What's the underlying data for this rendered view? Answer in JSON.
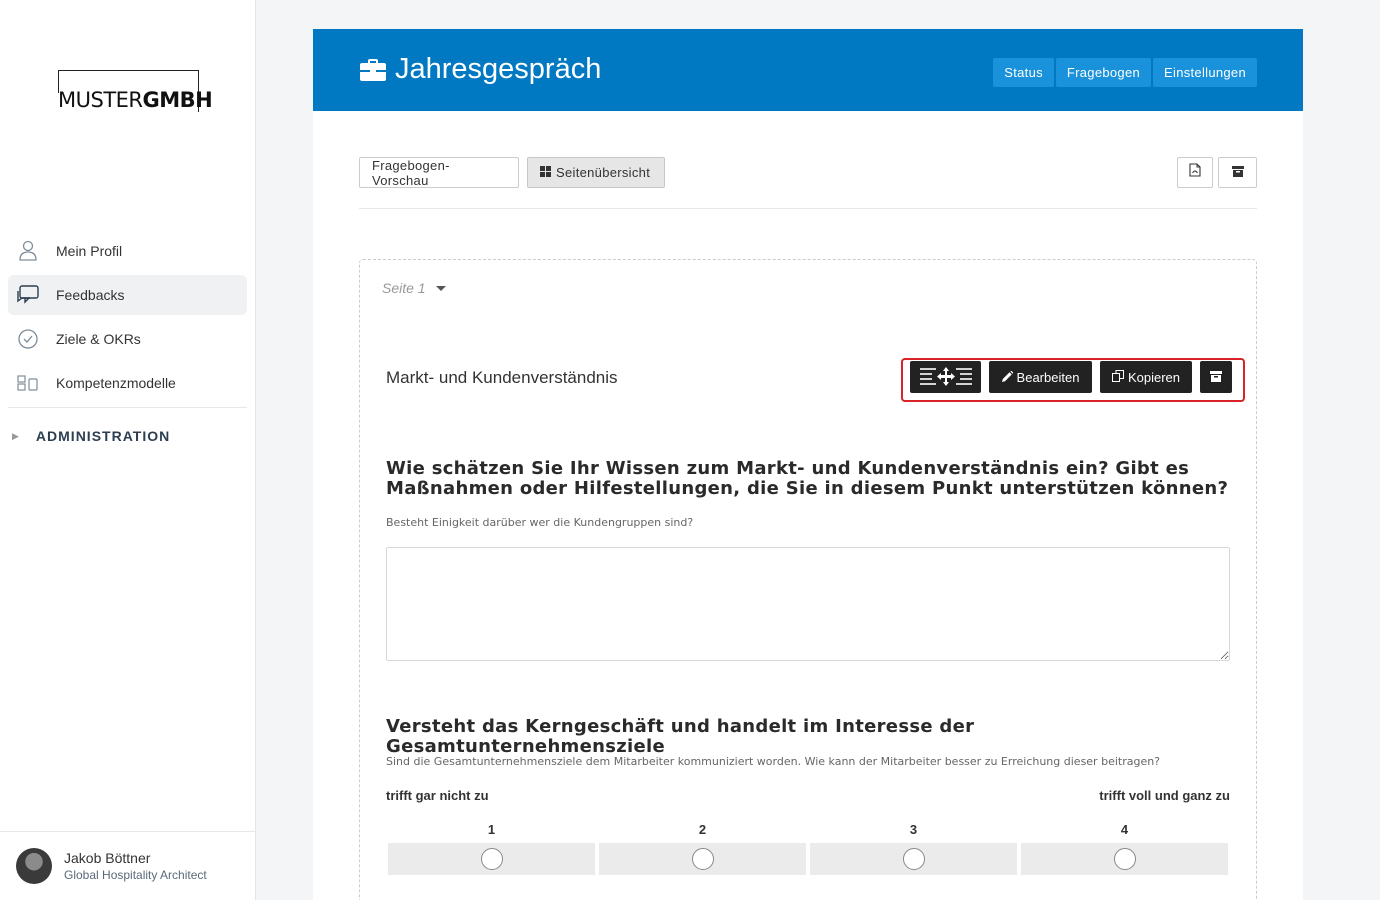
{
  "sidebar": {
    "logo": {
      "part1": "MUSTER",
      "part2": "GMBH"
    },
    "items": [
      {
        "label": "Mein Profil",
        "icon": "user-icon"
      },
      {
        "label": "Feedbacks",
        "icon": "chat-icon"
      },
      {
        "label": "Ziele & OKRs",
        "icon": "check-circle-icon"
      },
      {
        "label": "Kompetenzmodelle",
        "icon": "model-icon"
      }
    ],
    "admin_label": "ADMINISTRATION",
    "user": {
      "name": "Jakob Böttner",
      "role": "Global Hospitality Architect"
    }
  },
  "header": {
    "title": "Jahresgespräch",
    "buttons": [
      "Status",
      "Fragebogen",
      "Einstellungen"
    ]
  },
  "toolbar": {
    "preview_label": "Fragebogen-Vorschau",
    "overview_label": "Seitenübersicht"
  },
  "page": {
    "selector": "Seite 1",
    "section_title": "Markt- und Kundenverständnis",
    "actions": {
      "edit": "Bearbeiten",
      "copy": "Kopieren"
    },
    "questions": [
      {
        "title": "Wie schätzen Sie Ihr Wissen zum Markt- und Kundenverständnis ein? Gibt es Maßnahmen oder Hilfestellungen, die Sie in diesem Punkt unterstützen können?",
        "help": "Besteht Einigkeit darüber wer die Kundengruppen sind?"
      },
      {
        "title": "Versteht das Kerngeschäft und handelt im Interesse der Gesamtunternehmensziele",
        "help": "Sind die Gesamtunternehmensziele dem Mitarbeiter kommuniziert worden. Wie kann der Mitarbeiter besser zu Erreichung dieser beitragen?",
        "scale_min": "trifft gar nicht zu",
        "scale_max": "trifft voll und ganz zu",
        "scale": [
          "1",
          "2",
          "3",
          "4"
        ]
      }
    ]
  },
  "colors": {
    "header": "#0079c2",
    "header_button": "#1a92db",
    "highlight": "#d9232a",
    "action_button": "#222222"
  }
}
